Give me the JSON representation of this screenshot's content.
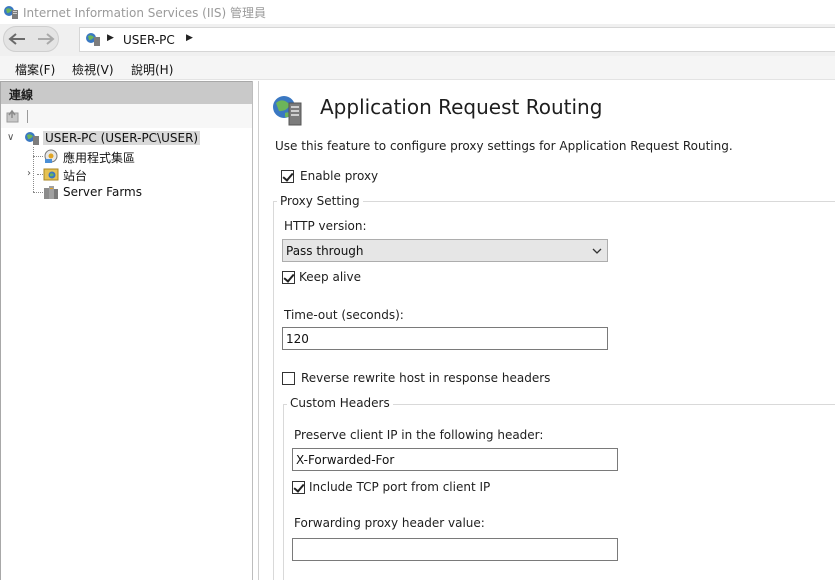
{
  "window": {
    "title": "Internet Information Services (IIS) 管理員"
  },
  "navbar": {
    "breadcrumb": "USER-PC"
  },
  "menu": {
    "items": [
      "檔案(F)",
      "檢視(V)",
      "說明(H)"
    ]
  },
  "connections": {
    "header": "連線",
    "tree": {
      "root": "USER-PC (USER-PC\\USER)",
      "children": [
        "應用程式集區",
        "站台",
        "Server Farms"
      ]
    }
  },
  "feature": {
    "title": "Application Request Routing",
    "description": "Use this feature to configure proxy settings for Application Request Routing.",
    "enable_proxy": {
      "label": "Enable proxy",
      "checked": true
    },
    "proxy_setting": {
      "legend": "Proxy Setting",
      "http_version_label": "HTTP version:",
      "http_version_value": "Pass through",
      "keep_alive": {
        "label": "Keep alive",
        "checked": true
      },
      "timeout_label": "Time-out (seconds):",
      "timeout_value": "120",
      "reverse_rewrite": {
        "label": "Reverse rewrite host in response headers",
        "checked": false
      },
      "custom_headers": {
        "legend": "Custom Headers",
        "preserve_ip_label": "Preserve client IP in the following header:",
        "preserve_ip_value": "X-Forwarded-For",
        "include_tcp_port": {
          "label": "Include TCP port from client IP",
          "checked": true
        },
        "forwarding_label": "Forwarding proxy header value:",
        "forwarding_value": ""
      }
    }
  }
}
